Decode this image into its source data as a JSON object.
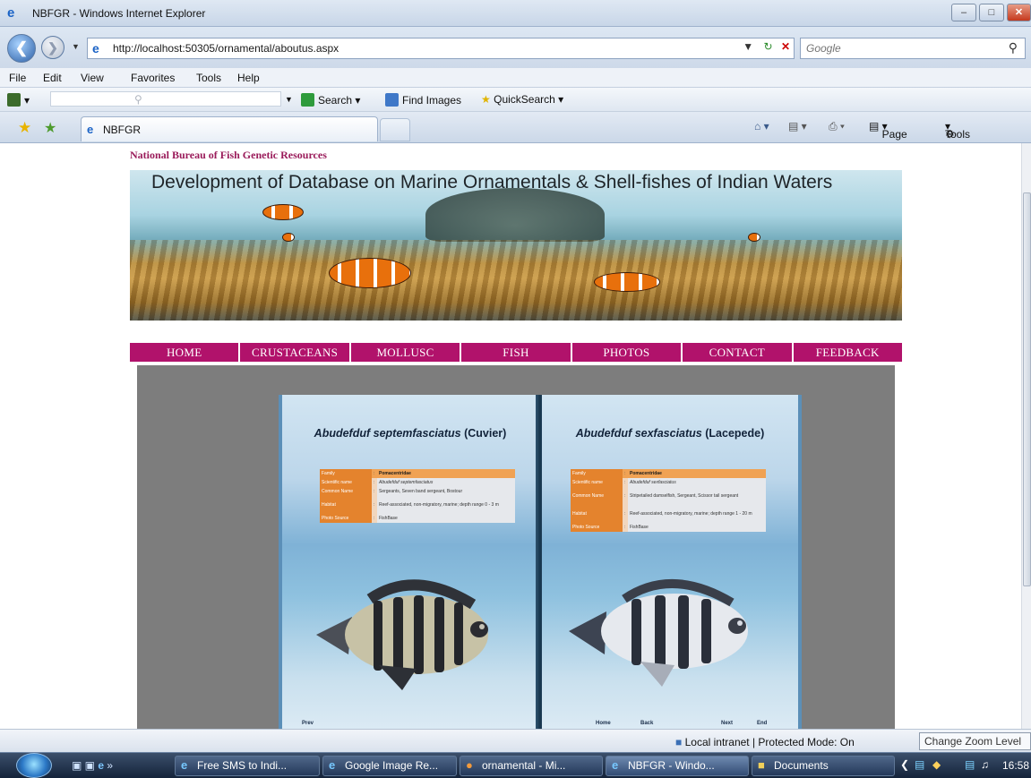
{
  "window": {
    "title": "NBFGR - Windows Internet Explorer"
  },
  "address": {
    "url": "http://localhost:50305/ornamental/aboutus.aspx",
    "search_placeholder": "Google"
  },
  "menu": [
    "File",
    "Edit",
    "View",
    "Favorites",
    "Tools",
    "Help"
  ],
  "toolbar": {
    "search_label": "Search",
    "find_images_label": "Find Images",
    "quicksearch_label": "QuickSearch"
  },
  "tab": {
    "title": "NBFGR"
  },
  "commandbar": {
    "page_label": "Page",
    "tools_label": "Tools"
  },
  "page": {
    "org_name": "National Bureau of Fish Genetic Resources",
    "banner_heading": "Development of Database on Marine Ornamentals & Shell-fishes of Indian Waters",
    "nav": [
      "HOME",
      "CRUSTACEANS",
      "MOLLUSC",
      "FISH",
      "PHOTOS",
      "CONTACT",
      "FEEDBACK"
    ],
    "left_page": {
      "species": "Abudefduf septemfasciatus",
      "author": "(Cuvier)",
      "rows": [
        {
          "key": "Family",
          "value": "Pomacentridae"
        },
        {
          "key": "Scientific name",
          "value": "Abudefduf septemfasciatus"
        },
        {
          "key": "Common Name",
          "value": "Sergeants, Seven band sergeant, Bostour"
        },
        {
          "key": "Habitat",
          "value": "Reef-associated, non-migratory, marine; depth range 0 - 3 m"
        },
        {
          "key": "Photo Source",
          "value": "FishBase"
        }
      ],
      "nav_prev": "Prev"
    },
    "right_page": {
      "species": "Abudefduf sexfasciatus",
      "author": "(Lacepede)",
      "rows": [
        {
          "key": "Family",
          "value": "Pomacentridae"
        },
        {
          "key": "Scientific name",
          "value": "Abudefduf sexfasciatus"
        },
        {
          "key": "Common Name",
          "value": "Stripetailed damselfish, Sergeant, Scissor tail sergeant"
        },
        {
          "key": "Habitat",
          "value": "Reef-associated, non-migratory, marine; depth range 1 - 20 m"
        },
        {
          "key": "Photo Source",
          "value": "FishBase"
        }
      ],
      "nav_home": "Home",
      "nav_back": "Back",
      "nav_next": "Next",
      "nav_end": "End"
    }
  },
  "statusbar": {
    "zone": "Local intranet | Protected Mode: On",
    "zoom": "Change Zoom Level"
  },
  "taskbar": {
    "buttons": [
      "Free SMS to Indi...",
      "Google Image Re...",
      "ornamental - Mi...",
      "NBFGR - Windo...",
      "Documents"
    ],
    "clock": "16:58"
  }
}
